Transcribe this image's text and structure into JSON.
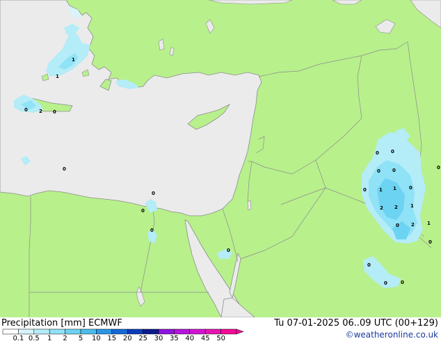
{
  "header": {
    "left_title": "Precipitation [mm]  ECMWF",
    "right_title": "Tu 07-01-2025 06..09 UTC (00+129)",
    "credit": "©weatheronline.co.uk"
  },
  "colors": {
    "land": "#b8f08c",
    "sea": "#ebebeb",
    "border": "#8c8c8c",
    "coast": "#8c8c8c"
  },
  "precip_labels": [
    "1",
    "1",
    "0",
    "2",
    "0",
    "0",
    "0",
    "0",
    "0",
    "0",
    "0",
    "0",
    "0",
    "0",
    "0",
    "1",
    "1",
    "0",
    "2",
    "2",
    "1",
    "0",
    "2",
    "1",
    "0",
    "0",
    "0",
    "0",
    "0"
  ],
  "colorbar": {
    "labels": [
      "0.1",
      "0.5",
      "1",
      "2",
      "5",
      "10",
      "15",
      "20",
      "25",
      "30",
      "35",
      "40",
      "45",
      "50"
    ],
    "colors": [
      "#ffffff",
      "#d8f4fa",
      "#b4ecf8",
      "#90e2f6",
      "#6cd3f2",
      "#4abdee",
      "#2896e6",
      "#1468d8",
      "#0a3cbc",
      "#0a1a8c",
      "#8c14dc",
      "#b414dc",
      "#d214d2",
      "#e614b4",
      "#f50a96"
    ]
  }
}
